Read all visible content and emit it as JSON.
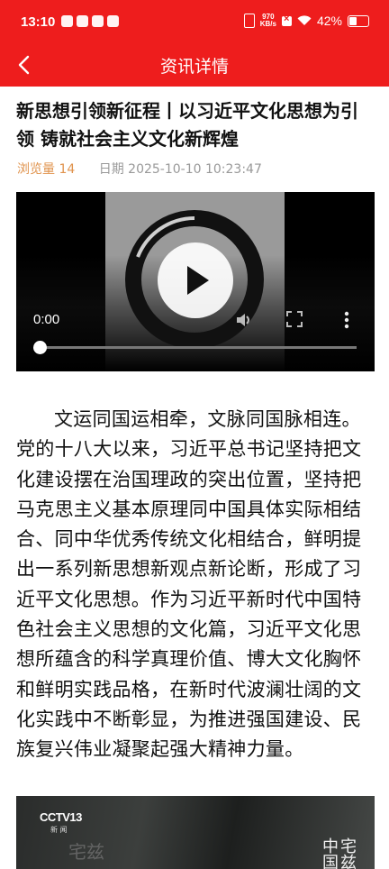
{
  "status_bar": {
    "time": "13:10",
    "net_speed_value": "970",
    "net_speed_unit": "KB/s",
    "battery": "42%"
  },
  "header": {
    "title": "资讯详情",
    "back_icon": "chevron-left-icon"
  },
  "article": {
    "title": "新思想引领新征程丨以习近平文化思想为引领 铸就社会主义文化新辉煌",
    "views_label": "浏览量 14",
    "date_label": "日期 2025-10-10 10:23:47",
    "video": {
      "time": "0:00",
      "progress": 0
    },
    "body": "文运同国运相牵，文脉同国脉相连。党的十八大以来，习近平总书记坚持把文化建设摆在治国理政的突出位置，坚持把马克思主义基本原理同中国具体实际相结合、同中华优秀传统文化相结合，鲜明提出一系列新思想新观点新论断，形成了习近平文化思想。作为习近平新时代中国特色社会主义思想的文化篇，习近平文化思想所蕴含的科学真理价值、博大文化胸怀和鲜明实践品格，在新时代波澜壮阔的文化实践中不断彰显，为推进强国建设、民族复兴伟业凝聚起强大精神力量。",
    "image": {
      "logo_text": "CCTV13",
      "logo_sub": "新 闻",
      "calligraphy_right": "中宅国兹",
      "calligraphy_left": "宅兹"
    }
  },
  "colors": {
    "brand_red": "#ee1d1d",
    "views_orange": "#e0934d",
    "meta_gray": "#999999"
  }
}
